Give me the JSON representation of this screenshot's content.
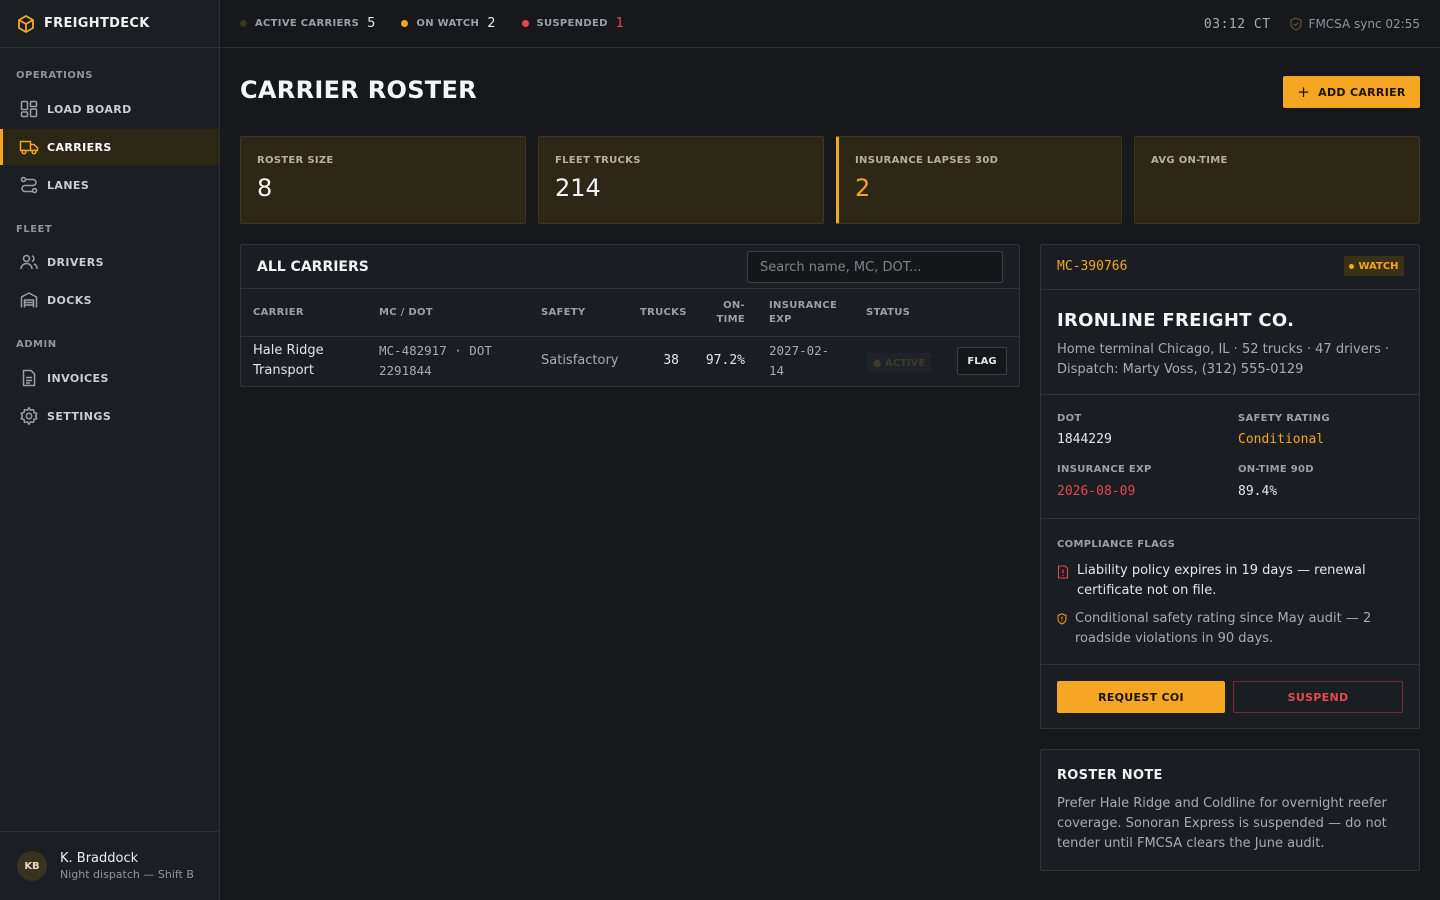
{
  "app": {
    "name": "FREIGHTDECK",
    "logo_icon": "box-icon"
  },
  "sidebar": {
    "sections": [
      {
        "label": "OPERATIONS"
      },
      {
        "label": "FLEET"
      },
      {
        "label": "ADMIN"
      }
    ],
    "items": [
      {
        "label": "LOAD BOARD",
        "icon": "dashboard-icon"
      },
      {
        "label": "CARRIERS",
        "icon": "truck-icon",
        "active": true
      },
      {
        "label": "LANES",
        "icon": "route-icon"
      },
      {
        "label": "DRIVERS",
        "icon": "users-icon"
      },
      {
        "label": "DOCKS",
        "icon": "warehouse-icon"
      },
      {
        "label": "INVOICES",
        "icon": "document-icon"
      },
      {
        "label": "SETTINGS",
        "icon": "gear-icon"
      }
    ],
    "user": {
      "initials": "KB",
      "name": "K. Braddock",
      "role": "Night dispatch — Shift B"
    }
  },
  "topbar": {
    "stats": [
      {
        "label": "ACTIVE CARRIERS",
        "value": "5",
        "color": "#3a3527"
      },
      {
        "label": "ON WATCH",
        "value": "2",
        "color": "#f5a623"
      },
      {
        "label": "SUSPENDED",
        "value": "1",
        "color": "#e5484d"
      }
    ],
    "clock": "03:12 CT",
    "sync": "FMCSA sync 02:55"
  },
  "page": {
    "title": "CARRIER ROSTER",
    "add_button": "ADD CARRIER"
  },
  "kpis": [
    {
      "label": "ROSTER SIZE",
      "value": "8"
    },
    {
      "label": "FLEET TRUCKS",
      "value": "214"
    },
    {
      "label": "INSURANCE LAPSES 30D",
      "value": "2"
    },
    {
      "label": "AVG ON-TIME",
      "value": ""
    }
  ],
  "carriers": {
    "title": "ALL CARRIERS",
    "search_placeholder": "Search name, MC, DOT...",
    "columns": {
      "carrier": "CARRIER",
      "mc_dot": "MC / DOT",
      "safety": "SAFETY",
      "trucks": "TRUCKS",
      "on_time_1": "ON-",
      "on_time_2": "TIME",
      "insurance_1": "INSURANCE",
      "insurance_2": "EXP",
      "status": "STATUS"
    },
    "rows": [
      {
        "name_1": "Hale Ridge",
        "name_2": "Transport",
        "mc_1": "MC-482917 · DOT",
        "mc_2": "2291844",
        "safety": "Satisfactory",
        "trucks": "38",
        "on_time": "97.2%",
        "ins_1": "2027-02-",
        "ins_2": "14",
        "status": "● ACTIVE",
        "action": "FLAG"
      }
    ]
  },
  "detail": {
    "mc": "MC-390766",
    "badge": "WATCH",
    "name": "IRONLINE FREIGHT CO.",
    "subtitle": "Home terminal Chicago, IL · 52 trucks · 47 drivers · Dispatch: Marty Voss, (312) 555-0129",
    "fields": {
      "dot_label": "DOT",
      "dot_value": "1844229",
      "safety_label": "SAFETY RATING",
      "safety_value": "Conditional",
      "ins_label": "INSURANCE EXP",
      "ins_value": "2026-08-09",
      "ontime_label": "ON-TIME 90D",
      "ontime_value": "89.4%"
    },
    "flags_label": "COMPLIANCE FLAGS",
    "flags": [
      {
        "text": "Liability policy expires in 19 days — renewal certificate not on file.",
        "severity": "danger",
        "icon": "alert-file-icon"
      },
      {
        "text": "Conditional safety rating since May audit — 2 roadside violations in 90 days.",
        "severity": "warn",
        "icon": "shield-alert-icon"
      }
    ],
    "request_button": "REQUEST COI",
    "suspend_button": "SUSPEND"
  },
  "note": {
    "title": "ROSTER NOTE",
    "text": "Prefer Hale Ridge and Coldline for overnight reefer coverage. Sonoran Express is suspended — do not tender until FMCSA clears the June audit."
  },
  "colors": {
    "accent": "#f5a623",
    "danger": "#e5484d",
    "bg": "#16181c",
    "panel": "#1a1d22",
    "kpi_bg": "#2d2715"
  }
}
